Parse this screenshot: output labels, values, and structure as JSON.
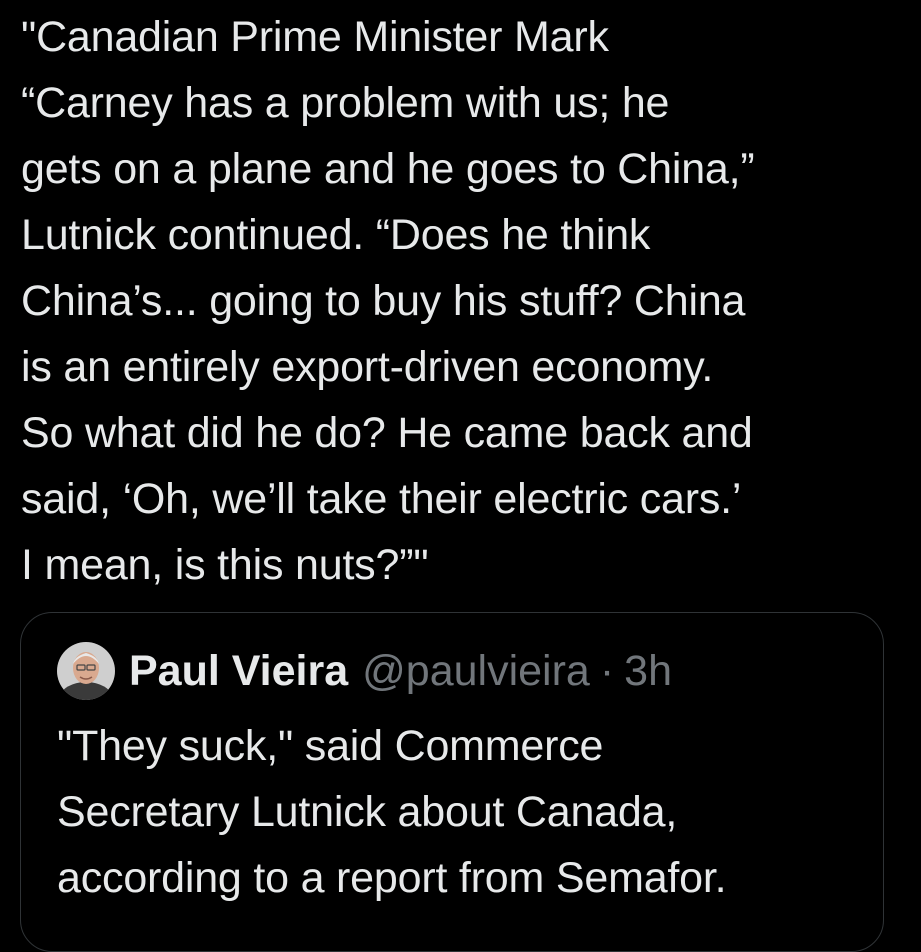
{
  "tweet": {
    "text": "\"Canadian Prime Minister Mark\n“Carney has a problem with us; he\ngets on a plane and he goes to China,”\nLutnick continued. “Does he think\nChina’s... going to buy his stuff? China\nis an entirely export-driven economy.\nSo what did he do? He came back and\nsaid, ‘Oh, we’ll take their electric cars.’\nI mean, is this nuts?”\""
  },
  "quoted_tweet": {
    "author_name": "Paul Vieira",
    "author_handle": "@paulvieira",
    "separator": "·",
    "timestamp": "3h",
    "avatar_icon": "person-avatar-icon",
    "text": "\"They suck,\" said Commerce\nSecretary Lutnick about Canada,\naccording to a report from Semafor."
  },
  "colors": {
    "background": "#000000",
    "primary_text": "#e7e9ea",
    "secondary_text": "#71767b",
    "border": "#2f3336"
  }
}
